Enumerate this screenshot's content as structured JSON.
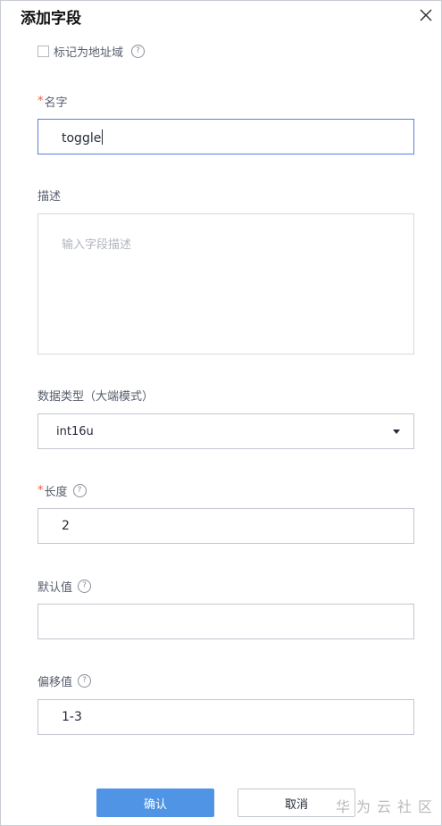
{
  "dialog": {
    "title": "添加字段",
    "close_icon": "close-icon"
  },
  "mark_address_field": {
    "label": "标记为地址域",
    "checked": false,
    "help_icon": "?"
  },
  "name": {
    "required_mark": "*",
    "label": "名字",
    "value": "toggle"
  },
  "description": {
    "label": "描述",
    "placeholder": "输入字段描述",
    "value": ""
  },
  "data_type": {
    "label": "数据类型（大端模式）",
    "value": "int16u"
  },
  "length": {
    "required_mark": "*",
    "label": "长度",
    "help_icon": "?",
    "value": "2"
  },
  "default_value": {
    "label": "默认值",
    "help_icon": "?",
    "value": ""
  },
  "offset": {
    "label": "偏移值",
    "help_icon": "?",
    "value": "1-3"
  },
  "buttons": {
    "confirm": "确认",
    "cancel": "取消"
  },
  "watermark": "华为云社区",
  "colors": {
    "primary": "#5094e6",
    "required": "#f15a46",
    "focus_border": "#5e7ce0"
  }
}
